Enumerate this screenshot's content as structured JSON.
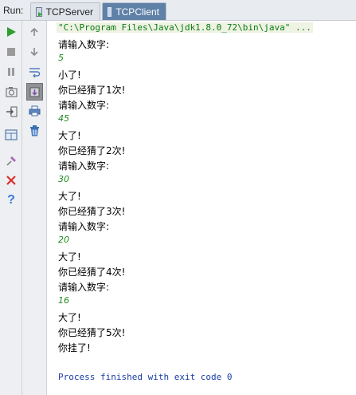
{
  "run_panel": {
    "label": "Run:",
    "tabs": [
      {
        "label": "TCPServer",
        "active": false
      },
      {
        "label": "TCPClient",
        "active": true
      }
    ]
  },
  "toolbar_left": [
    "rerun-icon",
    "stop-icon",
    "pause-icon",
    "dump-threads-icon",
    "exit-icon",
    "restore-layout-icon",
    "pin-tab-icon",
    "close-icon",
    "help-icon"
  ],
  "toolbar_right": [
    "scroll-up-icon",
    "scroll-down-icon",
    "soft-wrap-icon",
    "scroll-to-end-icon",
    "print-icon",
    "clear-all-icon"
  ],
  "console": {
    "command": "\"C:\\Program Files\\Java\\jdk1.8.0_72\\bin\\java\" ...",
    "lines": [
      {
        "text": "请输入数字:",
        "type": "out"
      },
      {
        "text": "5",
        "type": "inp"
      },
      {
        "text": "小了!",
        "type": "out"
      },
      {
        "text": "你已经猜了1次!",
        "type": "out"
      },
      {
        "text": "请输入数字:",
        "type": "out"
      },
      {
        "text": "45",
        "type": "inp"
      },
      {
        "text": "大了!",
        "type": "out"
      },
      {
        "text": "你已经猜了2次!",
        "type": "out"
      },
      {
        "text": "请输入数字:",
        "type": "out"
      },
      {
        "text": "30",
        "type": "inp"
      },
      {
        "text": "大了!",
        "type": "out"
      },
      {
        "text": "你已经猜了3次!",
        "type": "out"
      },
      {
        "text": "请输入数字:",
        "type": "out"
      },
      {
        "text": "20",
        "type": "inp"
      },
      {
        "text": "大了!",
        "type": "out"
      },
      {
        "text": "你已经猜了4次!",
        "type": "out"
      },
      {
        "text": "请输入数字:",
        "type": "out"
      },
      {
        "text": "16",
        "type": "inp"
      },
      {
        "text": "大了!",
        "type": "out"
      },
      {
        "text": "你已经猜了5次!",
        "type": "out"
      },
      {
        "text": "你挂了!",
        "type": "out"
      }
    ],
    "finish": "Process finished with exit code 0"
  },
  "colors": {
    "command_text": "#0b7a12",
    "user_input": "#1d8a1d",
    "finish_text": "#1a3ea8",
    "active_tab": "#5f81a8"
  }
}
